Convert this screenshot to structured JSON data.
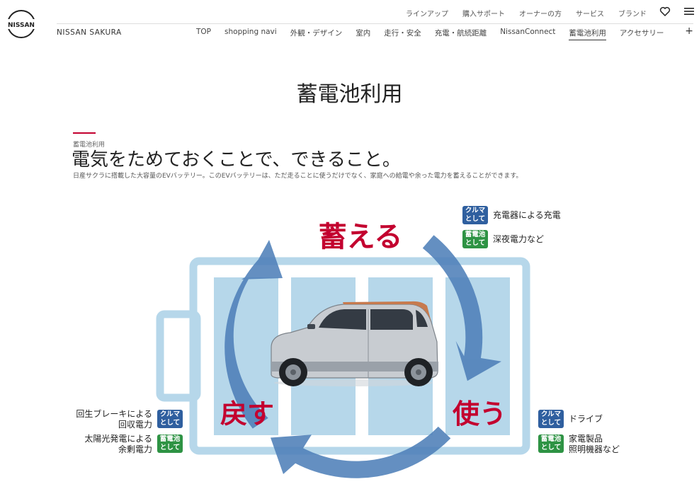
{
  "brand": {
    "logo_text": "NISSAN",
    "model_name": "NISSAN SAKURA"
  },
  "top_links": [
    "ラインアップ",
    "購入サポート",
    "オーナーの方",
    "サービス",
    "ブランド"
  ],
  "icons": {
    "favorite": "heart-icon",
    "menu": "hamburger-menu-icon",
    "expand": "plus-icon"
  },
  "nav": {
    "items": [
      "TOP",
      "shopping navi",
      "外観・デザイン",
      "室内",
      "走行・安全",
      "充電・航続距離",
      "NissanConnect",
      "蓄電池利用",
      "アクセサリー"
    ],
    "active_index": 7,
    "plus_label": "+"
  },
  "page": {
    "title": "蓄電池利用",
    "eyebrow": "蓄電池利用",
    "headline": "電気をためておくことで、できること。",
    "description": "日産サクラに搭載した大容量のEVバッテリー。このEVバッテリーは、ただ走ることに使うだけでなく、家庭への給電や余った電力を蓄えることができます。"
  },
  "diagram": {
    "store": "蓄える",
    "use": "使う",
    "return": "戻す",
    "tags": {
      "car_line1": "クルマ",
      "car_line2": "として",
      "battery_line1": "蓄電池",
      "battery_line2": "として"
    },
    "store_car": "充電器による充電",
    "store_battery": "深夜電力など",
    "use_car": "ドライブ",
    "use_battery_line1": "家電製品",
    "use_battery_line2": "照明機器など",
    "return_car_line1": "回生ブレーキによる",
    "return_car_line2": "回収電力",
    "return_battery_line1": "太陽光発電による",
    "return_battery_line2": "余剰電力"
  },
  "colors": {
    "accent_red": "#c3002f",
    "arrow_blue": "#4e7fb8",
    "battery_light": "#b6d7ea",
    "tag_blue": "#2f5f9f",
    "tag_green": "#2e9344"
  }
}
